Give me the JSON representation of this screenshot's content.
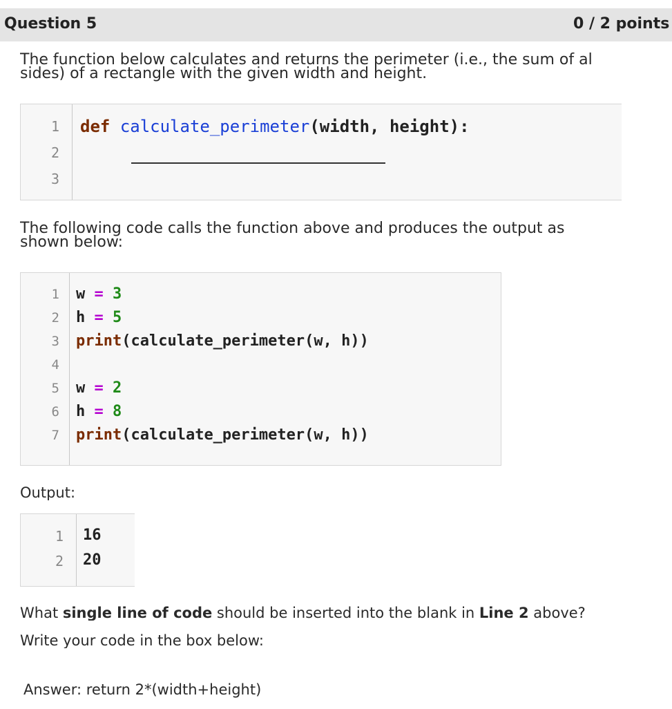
{
  "header": {
    "title": "Question 5",
    "points": "0 / 2 points"
  },
  "intro": {
    "line1": "The function below calculates and returns the perimeter (i.e., the sum of al",
    "line2": "sides) of a rectangle with the given width and height."
  },
  "code1": {
    "line_numbers": [
      "1",
      "2",
      "3"
    ],
    "keyword": "def",
    "function_name": "calculate_perimeter",
    "params": "(width, height):"
  },
  "calls_intro": {
    "line1": "The following code calls the function above and produces the output as",
    "line2": "shown below:"
  },
  "code2": {
    "line_numbers": [
      "1",
      "2",
      "3",
      "4",
      "5",
      "6",
      "7"
    ],
    "lines": [
      {
        "var": "w",
        "op": "=",
        "value": "3"
      },
      {
        "var": "h",
        "op": "=",
        "value": "5"
      },
      {
        "builtin": "print",
        "rest": "(calculate_perimeter(w, h))"
      },
      {},
      {
        "var": "w",
        "op": "=",
        "value": "2"
      },
      {
        "var": "h",
        "op": "=",
        "value": "8"
      },
      {
        "builtin": "print",
        "rest": "(calculate_perimeter(w, h))"
      }
    ]
  },
  "output": {
    "label": "Output:",
    "line_numbers": [
      "1",
      "2"
    ],
    "values": [
      "16",
      "20"
    ]
  },
  "question": {
    "prefix": "What ",
    "bold1": "single line of code",
    "middle": " should be inserted into the blank in ",
    "bold2": "Line 2",
    "suffix": " above?",
    "line2": "Write your code in the box below:"
  },
  "answer": {
    "text": "Answer: return 2*(width+height)"
  }
}
